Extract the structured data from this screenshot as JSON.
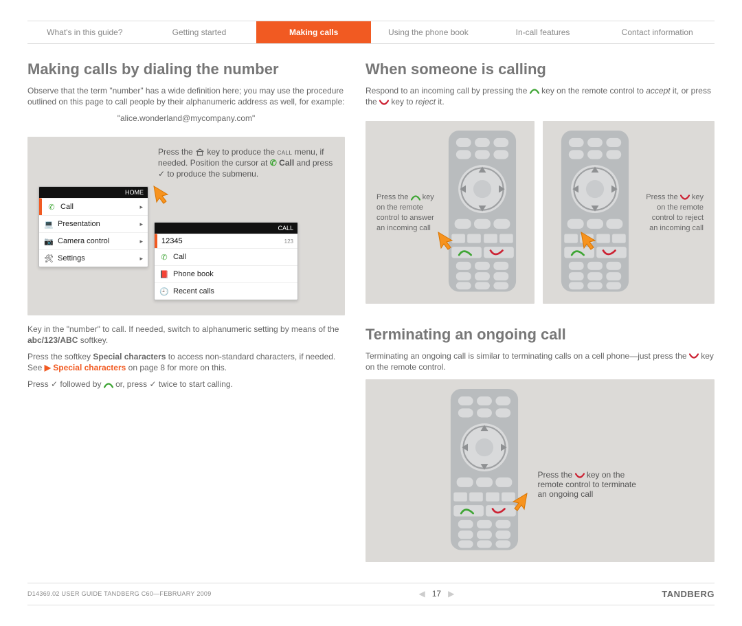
{
  "tabs": [
    "What's in this guide?",
    "Getting started",
    "Making calls",
    "Using the phone book",
    "In-call features",
    "Contact information"
  ],
  "active_tab": 2,
  "left": {
    "heading": "Making calls by dialing the number",
    "intro": "Observe that the term \"number\" has a wide definition here; you may use the procedure outlined on this page to call people by their alphanumeric address as well, for example:",
    "example": "\"alice.wonderland@mycompany.com\"",
    "panel_text": {
      "p1_a": "Press the ",
      "p1_b": " key to produce the ",
      "p1_c": "call",
      "p2": "menu, if needed. Position the cursor at ",
      "p2_bold": "Call",
      "p2_rest": " and press ",
      "p2_rest2": " to produce the submenu.",
      "check": "✓"
    },
    "menu1": {
      "title": "HOME",
      "items": [
        "Call",
        "Presentation",
        "Camera control",
        "Settings"
      ]
    },
    "menu2": {
      "title": "CALL",
      "input": "12345",
      "input_tag": "123",
      "items": [
        "Call",
        "Phone book",
        "Recent calls"
      ]
    },
    "below": {
      "p1_a": "Key in the \"number\" to call. If needed, switch to alphanumeric setting by means of the ",
      "p1_bold": "abc/123/ABC",
      "p1_b": " softkey.",
      "p2_a": "Press the softkey ",
      "p2_bold": "Special characters",
      "p2_b": " to access non-standard characters, if needed. See ",
      "p2_link": "Special characters",
      "p2_c": " on page 8 for more on this.",
      "p3_a": "Press ",
      "p3_b": " followed by ",
      "p3_c": " or, press ",
      "p3_d": " twice to start calling.",
      "check": "✓"
    }
  },
  "right": {
    "h1": "When someone is calling",
    "p1_a": "Respond to an incoming call by pressing the ",
    "p1_b": " key on the remote control to ",
    "p1_accept": "accept",
    "p1_c": " it, or press the ",
    "p1_d": " key to ",
    "p1_reject": "reject",
    "p1_e": " it.",
    "cap_a1": "Press the",
    "cap_a2": " key on the remote control to answer an incoming call",
    "cap_b1": "Press the",
    "cap_b2": " key on the remote control to reject an incoming call",
    "h2": "Terminating an ongoing call",
    "p2_a": "Terminating an ongoing call is similar to terminating calls on a cell phone—just press the ",
    "p2_b": " key on the remote control.",
    "cap_c1": "Press the ",
    "cap_c2": " key on the remote control to terminate an ongoing call"
  },
  "footer": {
    "left": "D14369.02 USER GUIDE TANDBERG C60—FEBRUARY 2009",
    "page": "17",
    "brand": "TANDBERG"
  }
}
